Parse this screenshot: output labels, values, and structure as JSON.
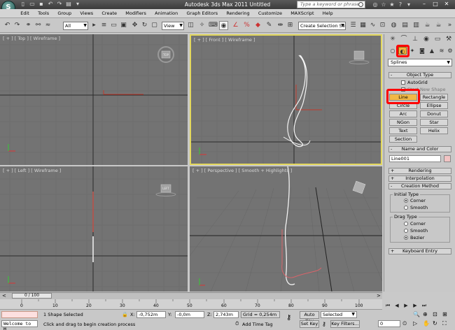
{
  "app": {
    "title": "Autodesk 3ds Max  2011     Untitled",
    "icon_letter": "S",
    "search_placeholder": "Type a keyword or phrase"
  },
  "menu": [
    "Edit",
    "Tools",
    "Group",
    "Views",
    "Create",
    "Modifiers",
    "Animation",
    "Graph Editors",
    "Rendering",
    "Customize",
    "MAXScript",
    "Help"
  ],
  "toolbar": {
    "selection_filter": "All",
    "reference_coord": "View",
    "named_selection": "Create Selection Se"
  },
  "viewports": {
    "top": "[ + ] [ Top ] [ Wireframe ]",
    "front": "[ + ] [ Front ] [ Wireframe ]",
    "left": "[ + ] [ Left ] [ Wireframe ]",
    "perspective": "[ + ] [ Perspective ] [ Smooth + Highlights ]",
    "cube_top": "TOP",
    "cube_left": "LEFT"
  },
  "command_panel": {
    "category": "Splines",
    "object_type_title": "Object Type",
    "autogrid": "AutoGrid",
    "start_new_shape": "Start New Shape",
    "buttons": [
      "Line",
      "Rectangle",
      "Circle",
      "Ellipse",
      "Arc",
      "Donut",
      "NGon",
      "Star",
      "Text",
      "Helix",
      "Section"
    ],
    "name_color_title": "Name and Color",
    "object_name": "Line001",
    "object_color": "#f2c3c3",
    "rendering_title": "Rendering",
    "interpolation_title": "Interpolation",
    "creation_method_title": "Creation Method",
    "initial_type_label": "Initial Type",
    "initial_type_options": [
      "Corner",
      "Smooth"
    ],
    "drag_type_label": "Drag Type",
    "drag_type_options": [
      "Corner",
      "Smooth",
      "Bezier"
    ],
    "keyboard_entry_title": "Keyboard Entry"
  },
  "timeline": {
    "slider": "0 / 100",
    "ticks": [
      "0",
      "10",
      "20",
      "30",
      "40",
      "50",
      "60",
      "70",
      "80",
      "90",
      "100"
    ]
  },
  "status": {
    "maxscript": "Welcome to M.",
    "selection": "1 Shape Selected",
    "prompt": "Click and drag to begin creation process",
    "x_label": "X:",
    "x": "-0,752m",
    "y_label": "Y:",
    "y": "-0,0m",
    "z_label": "Z:",
    "z": "2,743m",
    "grid": "Grid = 0,254m",
    "add_time_tag": "Add Time Tag",
    "auto_key": "Auto Key",
    "set_key": "Set Key",
    "key_mode": "Selected",
    "key_filters": "Key Filters...",
    "frame": "0"
  }
}
